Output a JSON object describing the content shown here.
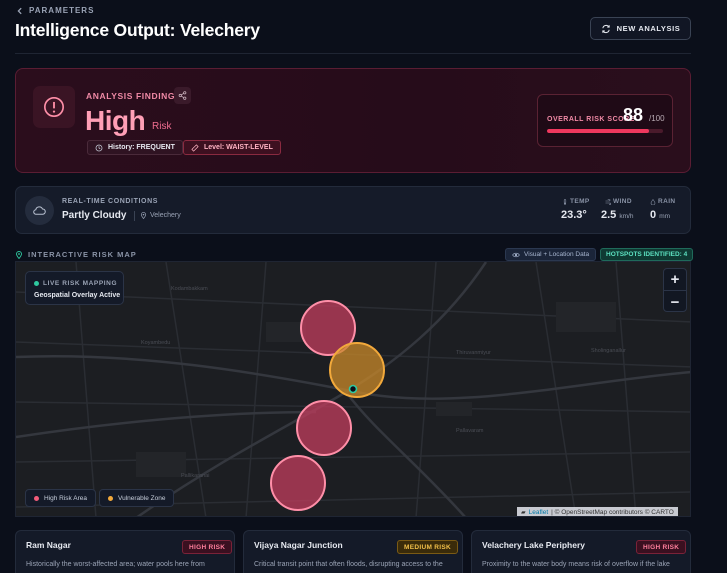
{
  "header": {
    "back_label": "PARAMETERS",
    "title": "Intelligence Output: Velechery",
    "new_analysis_label": "NEW ANALYSIS"
  },
  "findings": {
    "label": "ANALYSIS FINDINGS",
    "level": "High",
    "level_suffix": "Risk",
    "history_chip": "History: FREQUENT",
    "level_chip": "Level: WAIST-LEVEL",
    "score_label": "OVERALL RISK SCORE",
    "score": "88",
    "score_max": "/100",
    "score_fraction": 0.88
  },
  "conditions": {
    "label": "REAL-TIME CONDITIONS",
    "weather": "Partly Cloudy",
    "location": "Velechery",
    "temp_label": "TEMP",
    "temp_value": "23.3°",
    "wind_label": "WIND",
    "wind_value": "2.5",
    "wind_unit": "km/h",
    "rain_label": "RAIN",
    "rain_value": "0",
    "rain_unit": "mm"
  },
  "map": {
    "title": "INTERACTIVE RISK MAP",
    "visual_tag": "Visual + Location Data",
    "hotspots_tag": "HOTSPOTS IDENTIFIED: 4",
    "live_title": "LIVE RISK MAPPING",
    "live_subtitle": "Geospatial Overlay Active",
    "zoom_in": "+",
    "zoom_out": "−",
    "legend_high": "High Risk Area",
    "legend_vulnerable": "Vulnerable Zone",
    "attribution_leaflet": "Leaflet",
    "attribution_rest": "| © OpenStreetMap contributors © CARTO",
    "colors": {
      "high": "#f25c7a",
      "vulnerable": "#f2a93b",
      "marker": "#2fc9a0"
    }
  },
  "cards": [
    {
      "title": "Ram Nagar",
      "badge": "HIGH RISK",
      "desc": "Historically the worst-affected area; water pools here from"
    },
    {
      "title": "Vijaya Nagar Junction",
      "badge": "MEDIUM RISK",
      "desc": "Critical transit point that often floods, disrupting access to the"
    },
    {
      "title": "Velachery Lake Periphery",
      "badge": "HIGH RISK",
      "desc": "Proximity to the water body means risk of overflow if the lake"
    }
  ]
}
